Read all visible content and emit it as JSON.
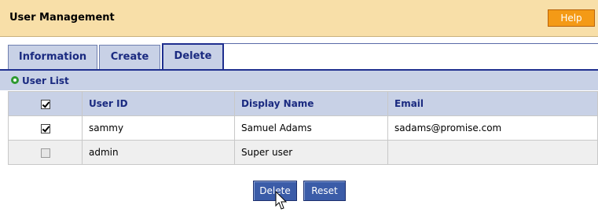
{
  "header": {
    "title": "User Management",
    "help_label": "Help"
  },
  "tabs": [
    {
      "label": "Information",
      "active": false
    },
    {
      "label": "Create",
      "active": false
    },
    {
      "label": "Delete",
      "active": true
    }
  ],
  "section": {
    "title": "User List"
  },
  "table": {
    "columns": [
      "User ID",
      "Display Name",
      "Email"
    ],
    "header_checked": true,
    "rows": [
      {
        "checked": true,
        "disabled": false,
        "user_id": "sammy",
        "display_name": "Samuel Adams",
        "email": "sadams@promise.com"
      },
      {
        "checked": false,
        "disabled": true,
        "user_id": "admin",
        "display_name": "Super user",
        "email": ""
      }
    ]
  },
  "actions": {
    "delete_label": "Delete",
    "reset_label": "Reset"
  },
  "colors": {
    "header_bg": "#f8dfa8",
    "help_button": "#f49a16",
    "tab_bg": "#c8d1e6",
    "button_bg": "#3b5ca8"
  }
}
